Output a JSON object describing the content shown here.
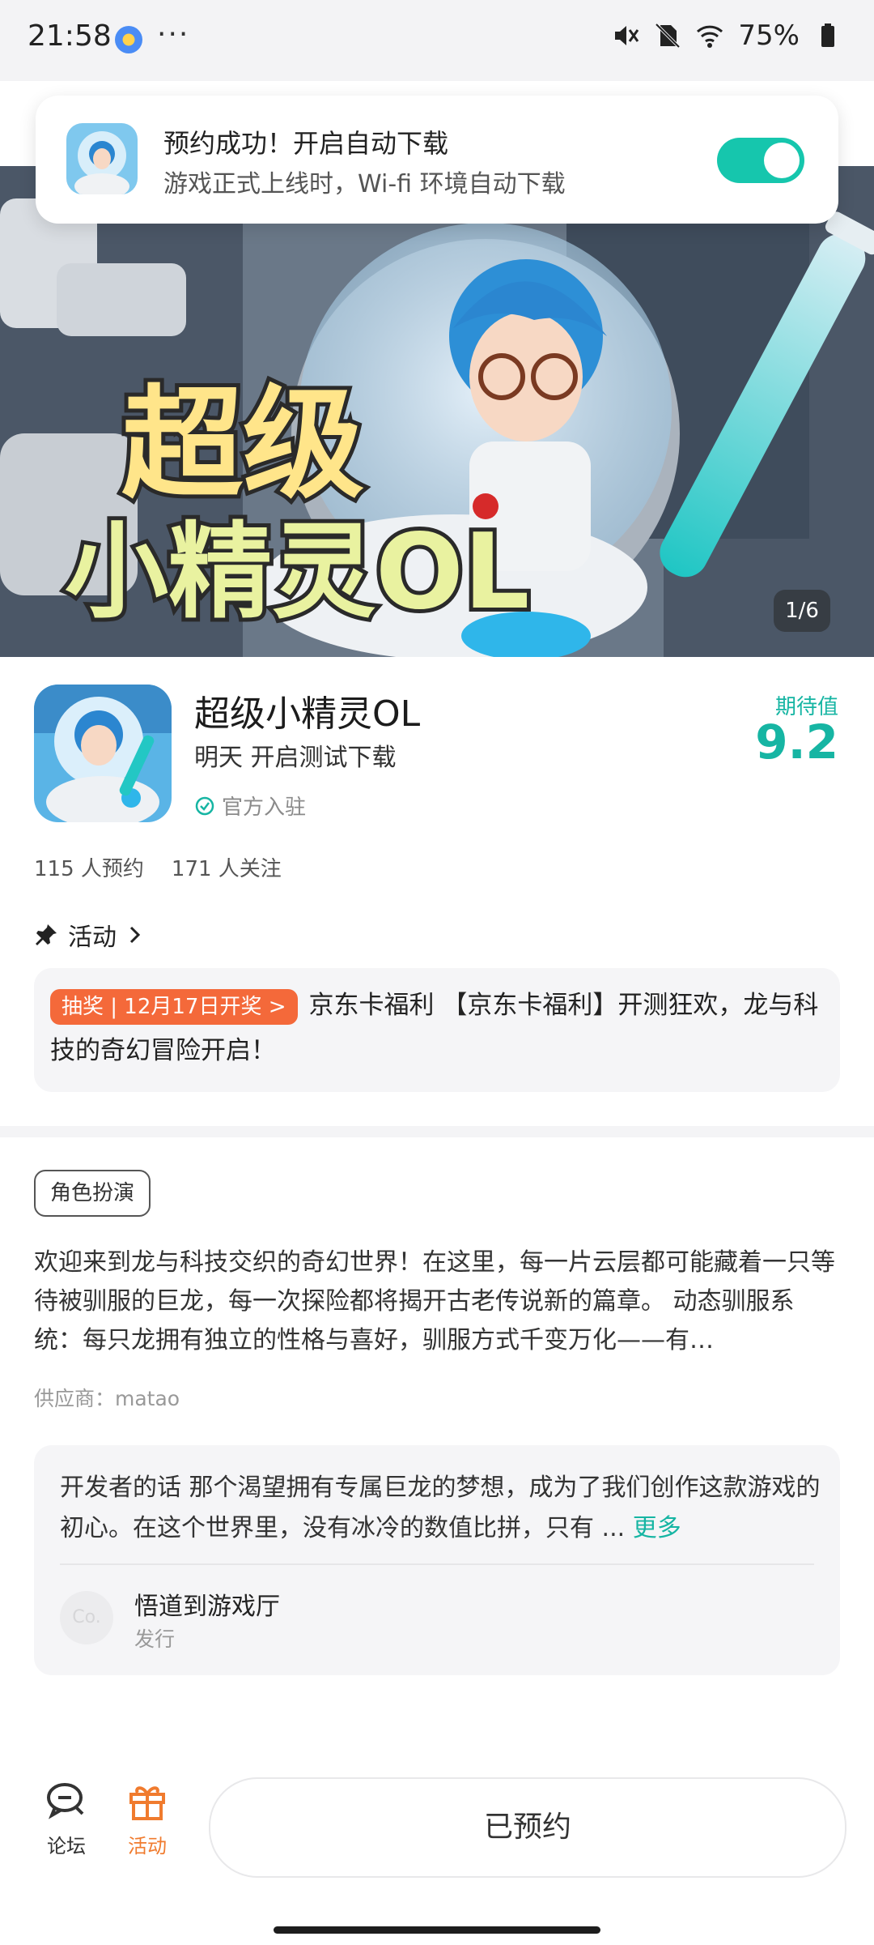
{
  "status_bar": {
    "time": "21:58",
    "more": "···",
    "battery": "75%"
  },
  "notification": {
    "title": "预约成功！开启自动下载",
    "subtitle": "游戏正式上线时，Wi-fi 环境自动下载",
    "toggle_on": true
  },
  "banner": {
    "logo_line1": "超级",
    "logo_line2": "小精灵OL",
    "pager": "1/6"
  },
  "game": {
    "name": "超级小精灵OL",
    "release": "明天 开启测试下载",
    "official": "官方入驻",
    "expect_label": "期待值",
    "expect_value": "9.2",
    "reservations": "115 人预约",
    "followers": "171 人关注"
  },
  "activity": {
    "heading": "活动",
    "badge": "抽奖 | 12月17日开奖 >",
    "text": "京东卡福利 【京东卡福利】开测狂欢，龙与科技的奇幻冒险开启！"
  },
  "details": {
    "tag": "角色扮演",
    "description": "欢迎来到龙与科技交织的奇幻世界！在这里，每一片云层都可能藏着一只等待被驯服的巨龙，每一次探险都将揭开古老传说新的篇章。 动态驯服系统：每只龙拥有独立的性格与喜好，驯服方式千变万化——有…",
    "supplier": "供应商：matao"
  },
  "developer": {
    "text": "开发者的话  那个渴望拥有专属巨龙的梦想，成为了我们创作这款游戏的初心。在这个世界里，没有冰冷的数值比拼，只有 ...",
    "more": "更多",
    "avatar_text": "Co.",
    "name": "悟道到游戏厅",
    "role": "发行"
  },
  "bottom_bar": {
    "forum_label": "论坛",
    "activity_label": "活动",
    "reserved_button": "已预约"
  },
  "colors": {
    "accent": "#16b5a3",
    "badge": "#f4693a",
    "activity_nav": "#f07b2e"
  }
}
